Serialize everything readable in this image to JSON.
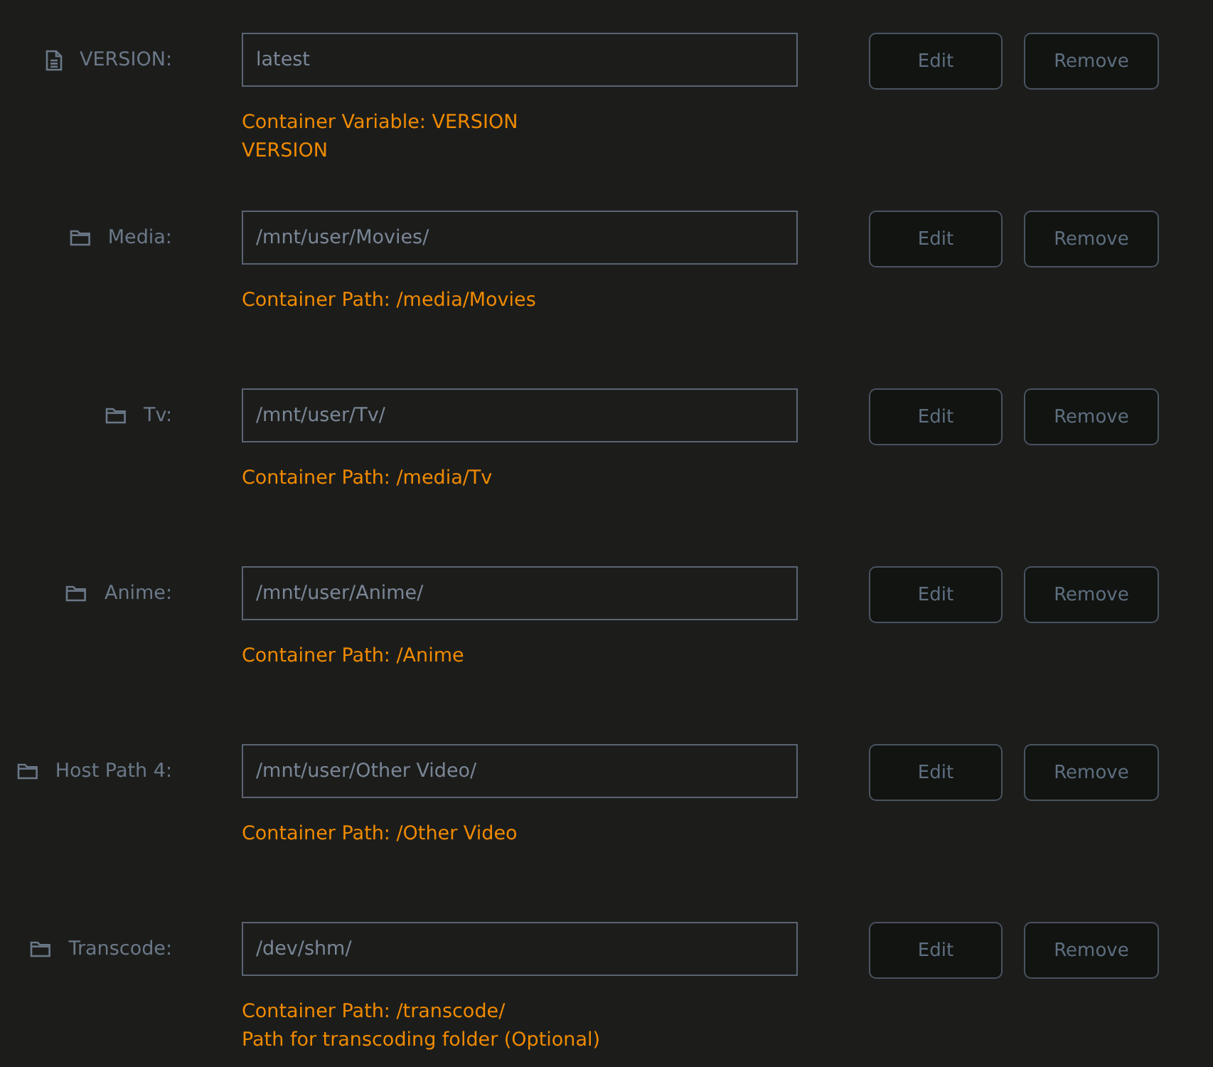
{
  "rows": [
    {
      "kind": "variable",
      "label": "VERSION:",
      "value": "latest",
      "description": [
        "Container Variable: VERSION",
        "VERSION"
      ],
      "buttons": [
        "Edit",
        "Remove"
      ]
    },
    {
      "kind": "path",
      "label": "Media:",
      "value": "/mnt/user/Movies/",
      "description": [
        "Container Path: /media/Movies"
      ],
      "buttons": [
        "Edit",
        "Remove"
      ]
    },
    {
      "kind": "path",
      "label": "Tv:",
      "value": "/mnt/user/Tv/",
      "description": [
        "Container Path: /media/Tv"
      ],
      "buttons": [
        "Edit",
        "Remove"
      ]
    },
    {
      "kind": "path",
      "label": "Anime:",
      "value": "/mnt/user/Anime/",
      "description": [
        "Container Path: /Anime"
      ],
      "buttons": [
        "Edit",
        "Remove"
      ]
    },
    {
      "kind": "path",
      "label": "Host Path 4:",
      "value": "/mnt/user/Other Video/",
      "description": [
        "Container Path: /Other Video"
      ],
      "buttons": [
        "Edit",
        "Remove"
      ]
    },
    {
      "kind": "path",
      "label": "Transcode:",
      "value": "/dev/shm/",
      "description": [
        "Container Path: /transcode/",
        "Path for transcoding folder (Optional)"
      ],
      "buttons": [
        "Edit",
        "Remove"
      ]
    }
  ]
}
